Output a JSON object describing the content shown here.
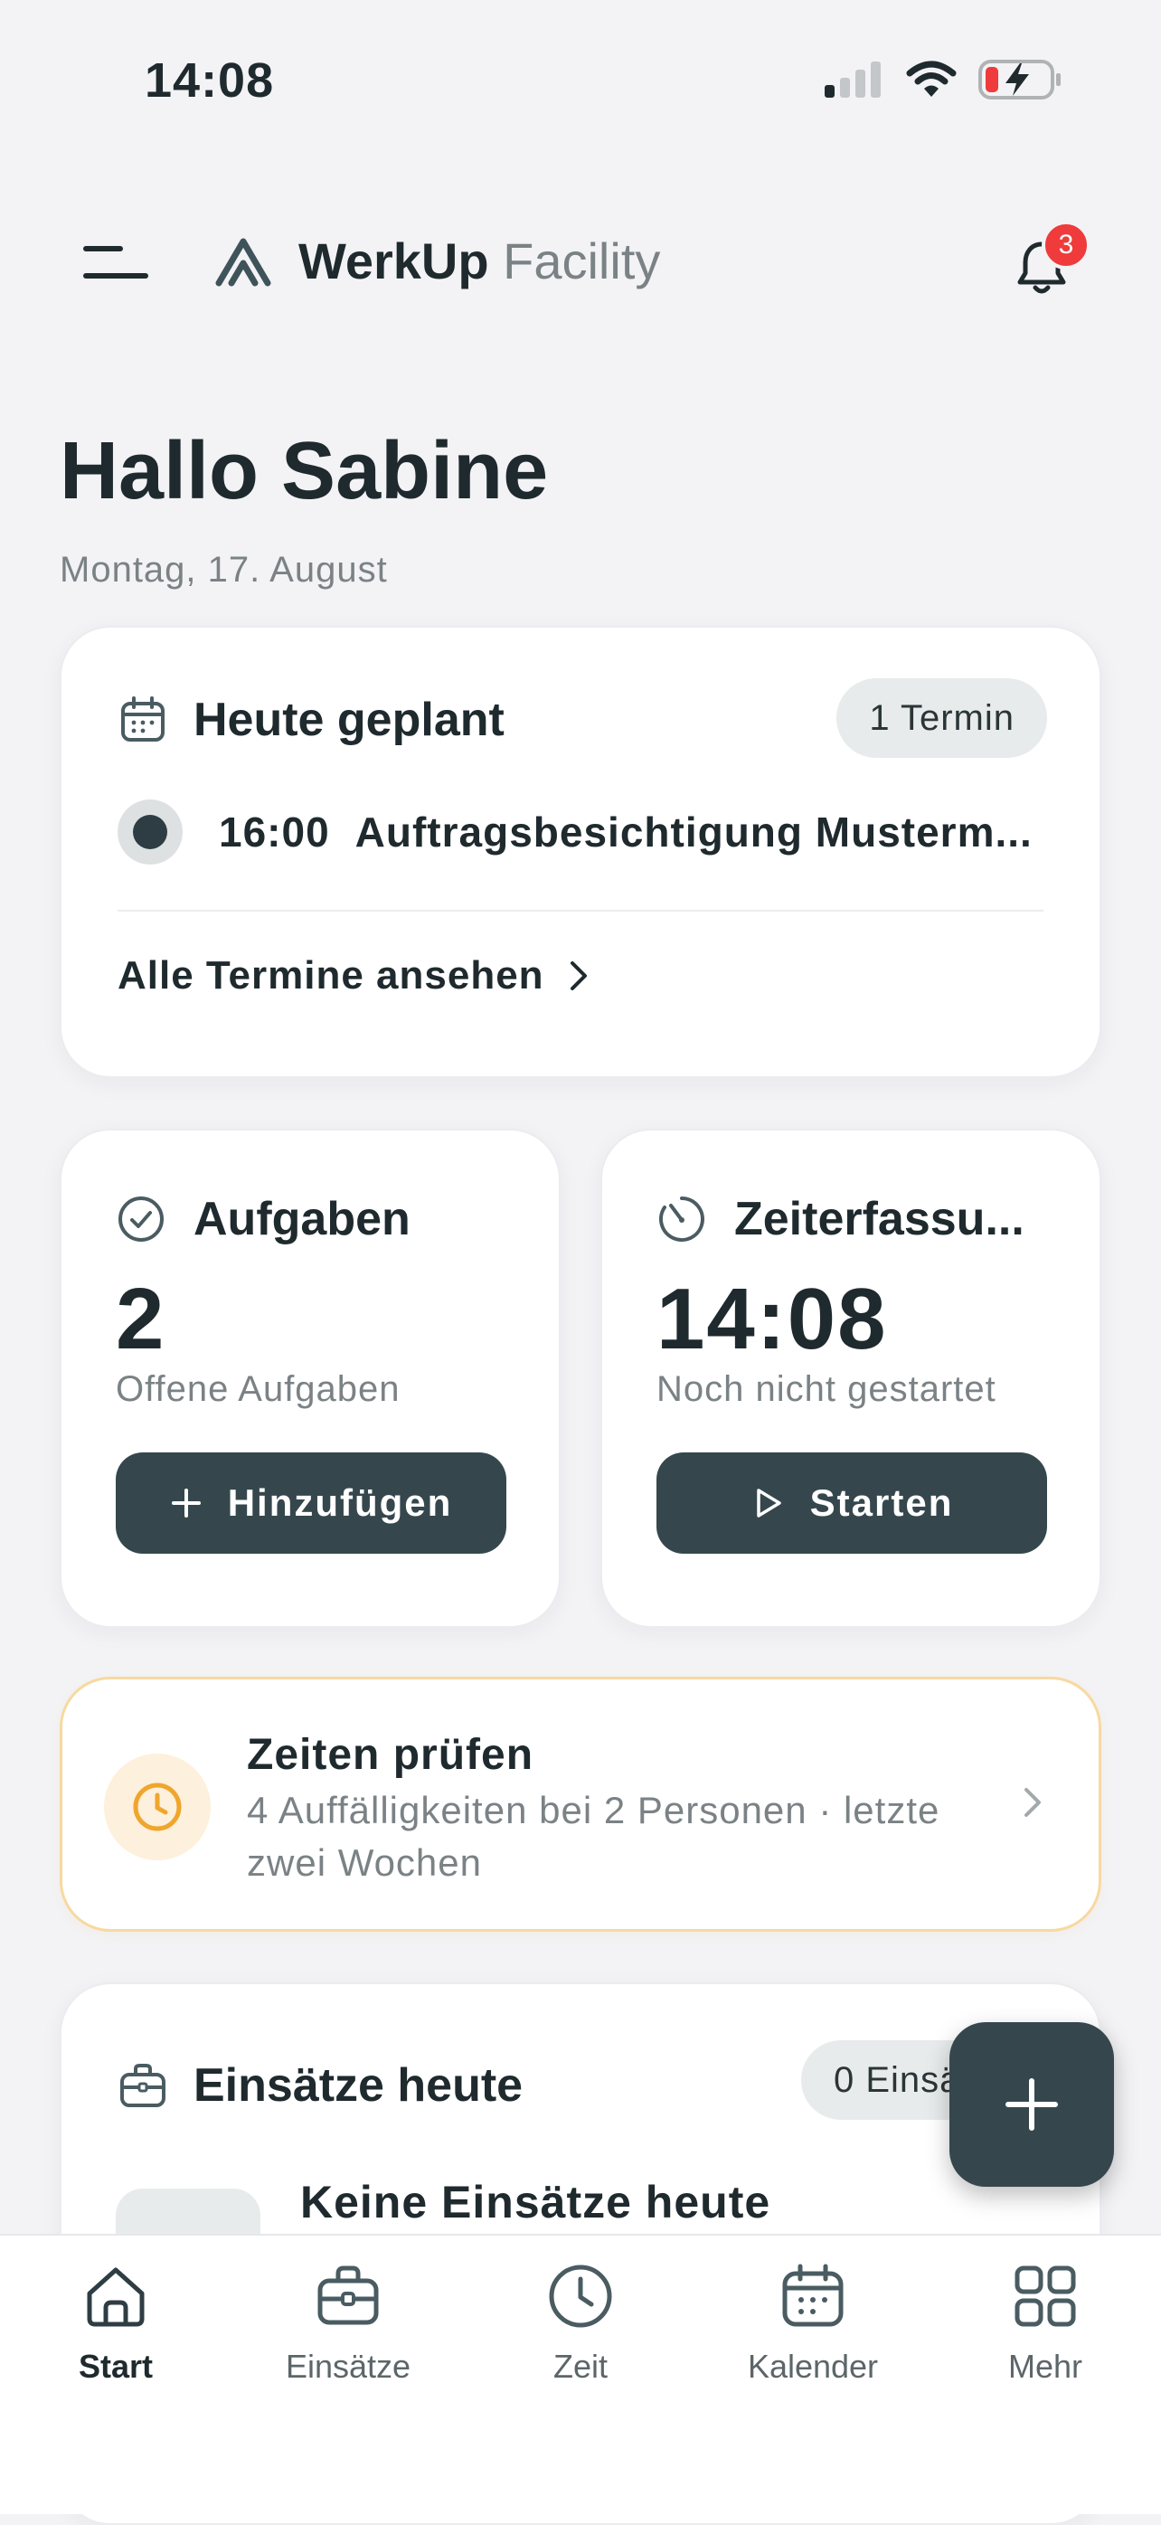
{
  "status_bar": {
    "time": "14:08"
  },
  "header": {
    "brand_bold": "WerkUp",
    "brand_light": "Facility",
    "notification_count": "3"
  },
  "greeting": {
    "title": "Hallo Sabine",
    "date": "Montag, 17. August"
  },
  "today_card": {
    "title": "Heute geplant",
    "count_pill": "1 Termin",
    "appointments": [
      {
        "time": "16:00",
        "title": "Auftragsbesichtigung Musterm..."
      }
    ],
    "link": "Alle Termine ansehen"
  },
  "tasks_card": {
    "title": "Aufgaben",
    "count": "2",
    "subtitle": "Offene Aufgaben",
    "button": "Hinzufügen"
  },
  "time_card": {
    "title": "Zeiterfassu...",
    "time": "14:08",
    "subtitle": "Noch nicht gestartet",
    "button": "Starten"
  },
  "check_card": {
    "title": "Zeiten prüfen",
    "subtitle": "4 Auffälligkeiten bei 2 Personen · letzte zwei Wochen"
  },
  "assign_card": {
    "title": "Einsätze heute",
    "count_pill": "0 Einsä",
    "empty_title": "Keine Einsätze heute"
  },
  "tabbar": {
    "items": [
      {
        "label": "Start",
        "icon": "home-icon"
      },
      {
        "label": "Einsätze",
        "icon": "briefcase-icon"
      },
      {
        "label": "Zeit",
        "icon": "clock-icon"
      },
      {
        "label": "Kalender",
        "icon": "calendar-icon"
      },
      {
        "label": "Mehr",
        "icon": "grid-icon"
      }
    ]
  },
  "colors": {
    "primary_dark": "#35474d",
    "background": "#f3f3f6",
    "badge_red": "#ef3b3b",
    "warning_border": "#f7d9a0",
    "warning_icon": "#f0a52c"
  }
}
